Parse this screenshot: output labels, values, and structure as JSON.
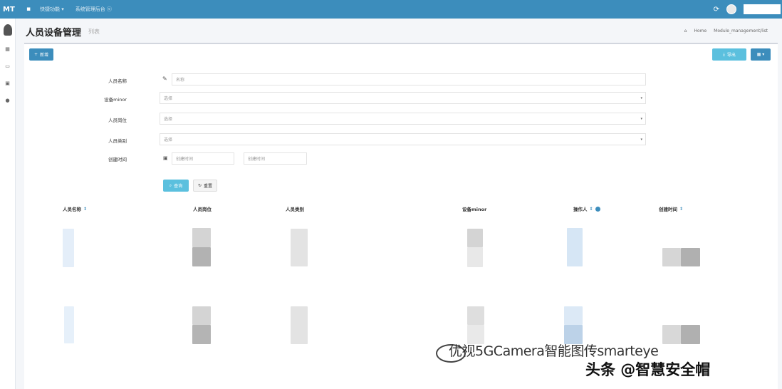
{
  "topbar": {
    "logo": "MT",
    "nav": [
      "快捷功能 ▾",
      "系统管理后台 ⓔ"
    ],
    "refresh_icon": "refresh-icon"
  },
  "sidebar": {
    "icons": [
      "dashboard-icon",
      "message-icon",
      "grid-icon",
      "user-icon"
    ]
  },
  "header": {
    "title": "人员设备管理",
    "subtitle": "列表",
    "breadcrumb": [
      "Home",
      "Module_management/list"
    ]
  },
  "toolbar": {
    "add_label": "新增",
    "export_label": "导出",
    "grid_label": "▦ ▾"
  },
  "form": {
    "fields": [
      {
        "label": "人员名称",
        "placeholder": "名称"
      },
      {
        "label": "设备minor",
        "placeholder": "选择"
      },
      {
        "label": "人员岗位",
        "placeholder": "选择"
      },
      {
        "label": "人员类别",
        "placeholder": "选择"
      }
    ],
    "date": {
      "label": "创建时间",
      "start_placeholder": "创建时间",
      "end_placeholder": "创建时间"
    },
    "search_label": "查询",
    "reset_label": "重置"
  },
  "table": {
    "headers": [
      "人员名称",
      "人员岗位",
      "人员类别",
      "设备minor",
      "操作人",
      "创建时间"
    ]
  },
  "watermark": {
    "line1": "优视5GCamera智能图传smarteye",
    "line2": "头条 @智慧安全帽"
  }
}
